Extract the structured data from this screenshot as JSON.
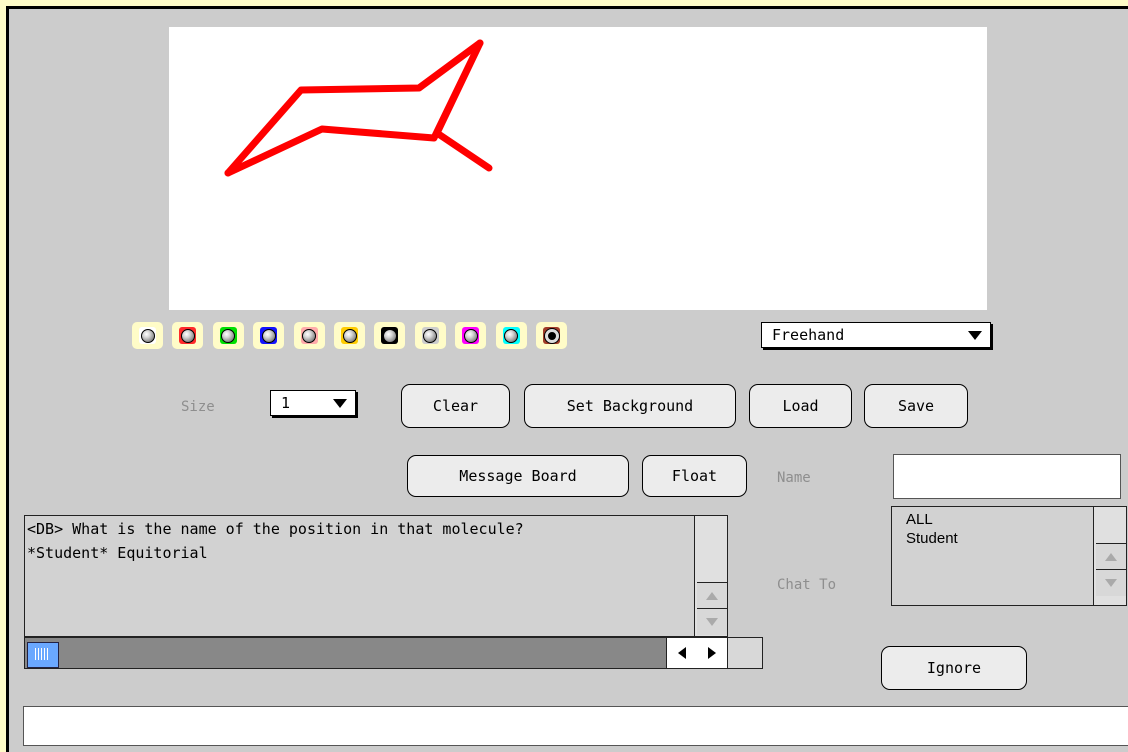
{
  "toolbar": {
    "colors": [
      {
        "name": "white",
        "hex": "#ffffff"
      },
      {
        "name": "red",
        "hex": "#ff2a2a"
      },
      {
        "name": "green",
        "hex": "#00e000"
      },
      {
        "name": "blue",
        "hex": "#1414ff"
      },
      {
        "name": "pink",
        "hex": "#ffaaaa"
      },
      {
        "name": "yellow",
        "hex": "#ffcc00"
      },
      {
        "name": "black",
        "hex": "#000000"
      },
      {
        "name": "gray",
        "hex": "#cccccc"
      },
      {
        "name": "magenta",
        "hex": "#ff00ff"
      },
      {
        "name": "cyan",
        "hex": "#00ffff"
      },
      {
        "name": "brown",
        "hex": "#a03c28"
      }
    ],
    "selected_color": "brown",
    "tool_value": "Freehand",
    "size_label": "Size",
    "size_value": "1",
    "clear_label": "Clear",
    "set_background_label": "Set Background",
    "load_label": "Load",
    "save_label": "Save"
  },
  "canvas": {
    "stroke_color": "#ff0000",
    "drawing": "chair-conformation-sketch"
  },
  "chat": {
    "message_board_label": "Message Board",
    "float_label": "Float",
    "name_label": "Name",
    "name_value": "",
    "messages": [
      "<DB> What is the name of the position in that molecule?",
      "*Student* Equitorial"
    ],
    "chat_to_label": "Chat To",
    "recipients": [
      "ALL",
      "Student"
    ],
    "ignore_label": "Ignore",
    "input_value": ""
  }
}
